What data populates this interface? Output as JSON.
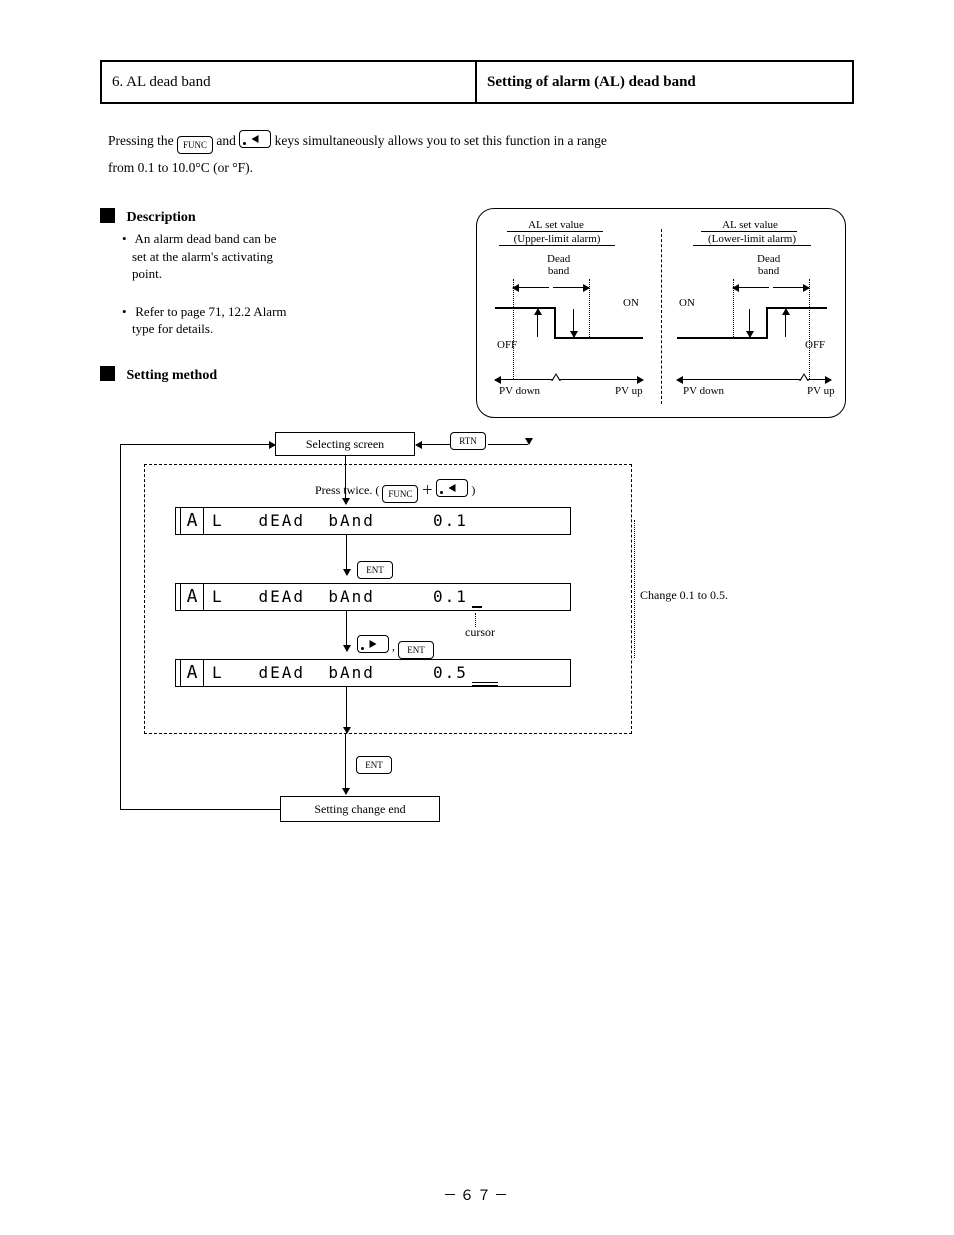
{
  "header": {
    "left": "6. AL dead band",
    "right": "Setting of alarm (AL) dead band"
  },
  "intro": {
    "line1_pre": "Pressing the ",
    "line1_mid": " and ",
    "line1_post": " keys simultaneously allows you to set this function in a range",
    "line2": "from 0.1 to 10.0°C (or °F)."
  },
  "description": {
    "title": "Description",
    "b1_l1": "An alarm dead band can be",
    "b1_l2": "set at the alarm's activating",
    "b1_l3": "point.",
    "b2_l1": "Refer to page 71, 12.2 Alarm",
    "b2_l2": "type for details."
  },
  "graphic": {
    "al_upper": "AL set value",
    "al_lower": "(Upper-limit alarm)",
    "al_upper2": "AL set value",
    "al_lower2": "(Lower-limit alarm)",
    "dead": "Dead",
    "band": "band",
    "on": "ON",
    "off": "OFF",
    "pvup": "PV up",
    "pvdown": "PV down"
  },
  "setting": {
    "title": "Setting method",
    "top": "Selecting screen",
    "return": "RTN",
    "step2_lead": "Press twice.  (",
    "step2_plus": "＋",
    "step2_end": ")",
    "lcd1": {
      "a": "A",
      "text": "L   dEAd  bAnd     0.1"
    },
    "step4": "ENT",
    "lcd2": {
      "a": "A",
      "text": "L   dEAd  bAnd     0.1"
    },
    "cursor_note": "cursor",
    "step6_sep": " , ",
    "lcd3": {
      "a": "A",
      "text": "L   dEAd  bAnd     0.5"
    },
    "step8": "ENT",
    "bottom": "Setting change end",
    "explain": "Change 0.1 to 0.5.",
    "func": "FUNC",
    "ent": "ENT"
  },
  "page": "－６７－"
}
